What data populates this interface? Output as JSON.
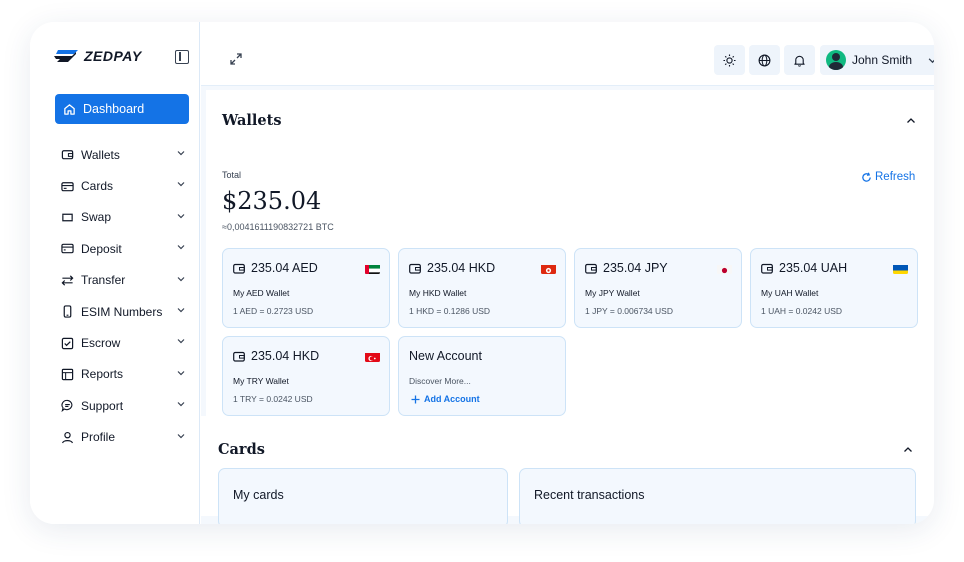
{
  "brand": {
    "name": "ZEDPAY"
  },
  "nav": {
    "active": {
      "label": "Dashboard",
      "icon": "home-icon"
    },
    "items": [
      {
        "label": "Wallets",
        "icon": "wallet-icon"
      },
      {
        "label": "Cards",
        "icon": "card-icon"
      },
      {
        "label": "Swap",
        "icon": "swap-icon"
      },
      {
        "label": "Deposit",
        "icon": "deposit-icon"
      },
      {
        "label": "Transfer",
        "icon": "transfer-icon"
      },
      {
        "label": "ESIM Numbers",
        "icon": "phone-icon"
      },
      {
        "label": "Escrow",
        "icon": "checkbox-icon"
      },
      {
        "label": "Reports",
        "icon": "table-icon"
      },
      {
        "label": "Support",
        "icon": "chat-icon"
      },
      {
        "label": "Profile",
        "icon": "user-icon"
      }
    ]
  },
  "header": {
    "user_name": "John Smith"
  },
  "wallets": {
    "title": "Wallets",
    "total_label": "Total",
    "total_amount": "$235.04",
    "btc_equivalent": "≈0,0041611190832721 BTC",
    "refresh_label": "Refresh",
    "cards": [
      {
        "amount": "235.04 AED",
        "name": "My AED Wallet",
        "rate": "1 AED = 0.2723 USD",
        "flag": "uae-flag-icon"
      },
      {
        "amount": "235.04 HKD",
        "name": "My HKD Wallet",
        "rate": "1 HKD = 0.1286 USD",
        "flag": "hong-kong-flag-icon"
      },
      {
        "amount": "235.04 JPY",
        "name": "My JPY Wallet",
        "rate": "1 JPY = 0.006734 USD",
        "flag": "japan-flag-icon"
      },
      {
        "amount": "235.04 UAH",
        "name": "My UAH Wallet",
        "rate": "1 UAH = 0.0242 USD",
        "flag": "ukraine-flag-icon"
      },
      {
        "amount": "235.04 HKD",
        "name": "My TRY Wallet",
        "rate": "1 TRY = 0.0242 USD",
        "flag": "turkey-flag-icon"
      }
    ],
    "new_account": {
      "title": "New Account",
      "subtitle": "Discover More...",
      "add_label": "Add Account"
    }
  },
  "cards_section": {
    "title": "Cards",
    "my_cards": "My cards",
    "recent_transactions": "Recent transactions"
  },
  "colors": {
    "accent": "#1473e6",
    "card_bg": "#f3f8fe",
    "card_border": "#cde3f7"
  }
}
